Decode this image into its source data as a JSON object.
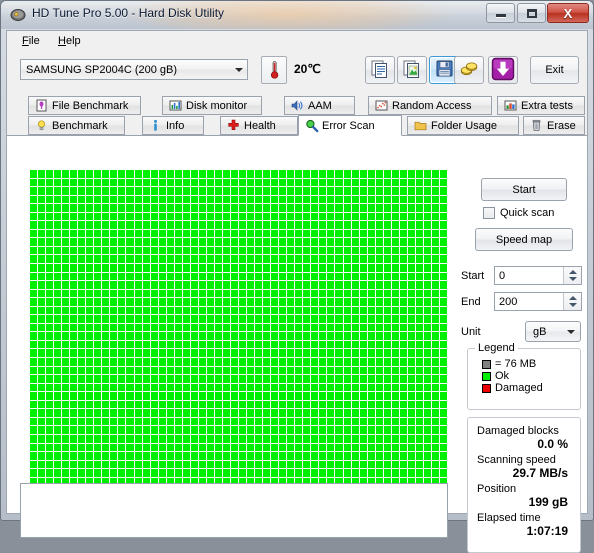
{
  "window": {
    "title": "HD Tune Pro 5.00 - Hard Disk Utility",
    "app_icon": "hard-disk-icon",
    "minimize_label": "Minimize",
    "maximize_label": "Maximize",
    "close_label": "X"
  },
  "menubar": {
    "items": [
      {
        "label": "File",
        "accel": "F"
      },
      {
        "label": "Help",
        "accel": "H"
      }
    ]
  },
  "toolbar": {
    "device": {
      "value": "SAMSUNG SP2004C (200 gB)",
      "icon": "chevron-down-icon"
    },
    "temperature": {
      "icon": "thermometer-icon",
      "value": "20℃"
    },
    "buttons": [
      {
        "name": "copy-text-button",
        "icon": "copy-text-icon",
        "selected": false
      },
      {
        "name": "copy-image-button",
        "icon": "copy-image-icon",
        "selected": false
      },
      {
        "name": "save-button",
        "icon": "floppy-save-icon",
        "selected": true
      },
      {
        "name": "options-button",
        "icon": "coins-icon",
        "selected": false
      },
      {
        "name": "download-button",
        "icon": "purple-down-arrow-icon",
        "selected": false
      }
    ],
    "exit_label": "Exit"
  },
  "tabs": {
    "row1": [
      {
        "label": "File Benchmark",
        "icon": "file-benchmark-icon",
        "active": false
      },
      {
        "label": "Disk monitor",
        "icon": "bar-chart-icon",
        "active": false
      },
      {
        "label": "AAM",
        "icon": "speaker-icon",
        "active": false
      },
      {
        "label": "Random Access",
        "icon": "scatter-icon",
        "active": false
      },
      {
        "label": "Extra tests",
        "icon": "extra-tests-icon",
        "active": false
      }
    ],
    "row2": [
      {
        "label": "Benchmark",
        "icon": "lightbulb-icon",
        "active": false
      },
      {
        "label": "Info",
        "icon": "info-icon",
        "active": false
      },
      {
        "label": "Health",
        "icon": "red-cross-icon",
        "active": false
      },
      {
        "label": "Error Scan",
        "icon": "magnifier-icon",
        "active": true
      },
      {
        "label": "Folder Usage",
        "icon": "folder-icon",
        "active": false
      },
      {
        "label": "Erase",
        "icon": "trash-icon",
        "active": false
      }
    ]
  },
  "scan": {
    "columns": 52,
    "rows": 40,
    "ok_color": "#00ee00",
    "damaged_color": "#ff0000",
    "background_color": "#000000",
    "log_text": ""
  },
  "controls": {
    "start_button": "Start",
    "quick_scan_label": "Quick scan",
    "quick_scan_checked": false,
    "speed_map_button": "Speed map",
    "start_field": {
      "label": "Start",
      "value": "0"
    },
    "end_field": {
      "label": "End",
      "value": "200"
    },
    "unit_field": {
      "label": "Unit",
      "value": "gB",
      "icon": "chevron-down-icon"
    }
  },
  "legend": {
    "title": "Legend",
    "items": [
      {
        "swatch": "#808080",
        "text": "= 76 MB"
      },
      {
        "swatch": "#00ee00",
        "text": "Ok"
      },
      {
        "swatch": "#ee0000",
        "text": "Damaged"
      }
    ]
  },
  "stats": {
    "rows": [
      {
        "label": "Damaged blocks",
        "value": "0.0 %"
      },
      {
        "label": "Scanning speed",
        "value": "29.7 MB/s"
      },
      {
        "label": "Position",
        "value": "199 gB"
      },
      {
        "label": "Elapsed time",
        "value": "1:07:19"
      }
    ]
  }
}
